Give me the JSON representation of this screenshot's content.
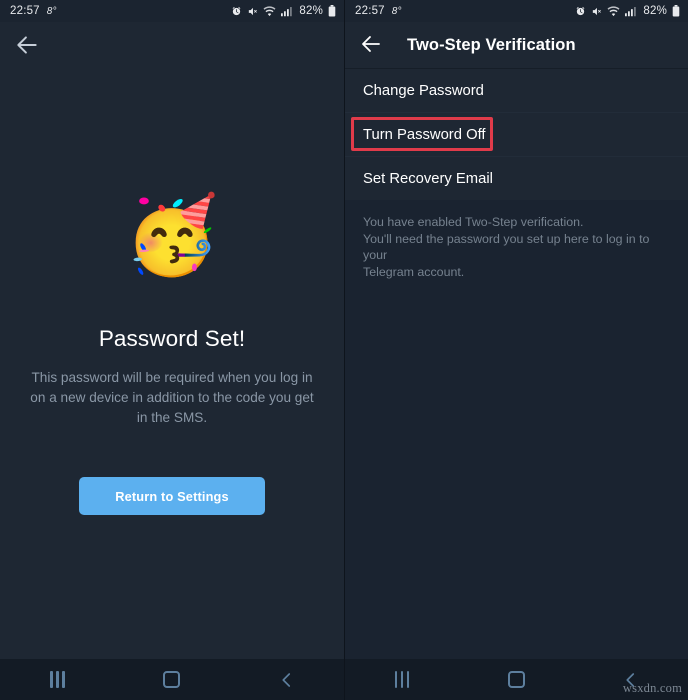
{
  "status_bar": {
    "time": "22:57",
    "temperature": "8°",
    "battery": "82%",
    "icons": [
      "alarm-icon",
      "mute-icon",
      "wifi-icon",
      "signal-icon",
      "battery-icon"
    ]
  },
  "left_screen": {
    "back_icon": "back-arrow-icon",
    "emoji": "🥳",
    "emoji_name": "party-face-emoji",
    "headline": "Password Set!",
    "subtext": "This password will be required when you log in on a new device in addition to the code you get in the SMS.",
    "button_label": "Return to Settings"
  },
  "right_screen": {
    "back_icon": "back-arrow-icon",
    "title": "Two-Step Verification",
    "menu_items": [
      {
        "label": "Change Password",
        "highlighted": false
      },
      {
        "label": "Turn Password Off",
        "highlighted": true
      },
      {
        "label": "Set Recovery Email",
        "highlighted": false
      }
    ],
    "hint_lines": [
      "You have enabled Two-Step verification.",
      "You'll need the password you set up here to log in to your",
      "Telegram account."
    ]
  },
  "nav_bar": {
    "recents_label": "recents-button",
    "home_label": "home-button",
    "back_label": "back-button"
  },
  "watermark": "wsxdn.com",
  "colors": {
    "background": "#1e2733",
    "panel_alt": "#1a2330",
    "accent_button": "#5cb0ef",
    "highlight_red": "#e03b4a",
    "nav_icon": "#5d7f9e",
    "muted_text": "#8a97a6"
  }
}
